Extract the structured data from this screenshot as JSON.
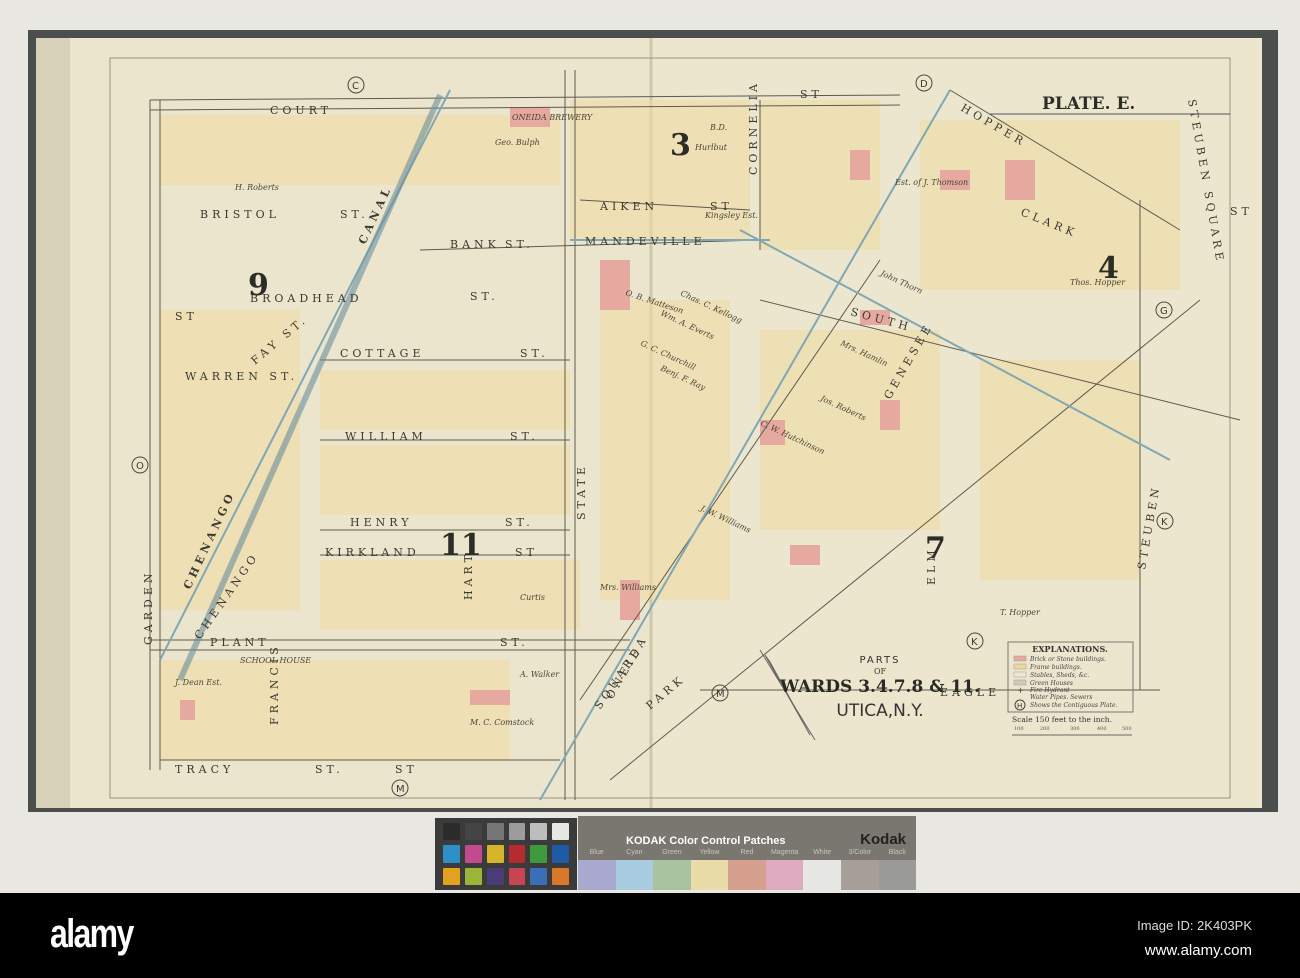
{
  "plate_title": "PLATE. E.",
  "cartouche": {
    "line1": "PARTS",
    "line2": "OF",
    "line3": "WARDS 3.4.7.8 & 11.",
    "line4": "UTICA,N.Y."
  },
  "legend": {
    "title": "EXPLANATIONS.",
    "items": [
      "Brick or Stone buildings.",
      "Frame buildings.",
      "Stables, Sheds, &c.",
      "Green Houses",
      "Fire Hydrant",
      "Water Pipes.  Sewers",
      "Shows the Contiguous Plate."
    ],
    "hydrant_symbol": "+",
    "plate_symbol": "H",
    "scale": "Scale 150 feet to the inch.",
    "scale_ticks": [
      "100",
      "200",
      "300",
      "400",
      "500"
    ],
    "colors": {
      "brick": "#e6a9a0",
      "frame": "#efd79a",
      "stable": "#ece8d4",
      "green": "#cfcab7"
    }
  },
  "streets": [
    "COURT",
    "ST",
    "BROADHEAD",
    "ST.",
    "BRISTOL",
    "ST.",
    "AIKEN",
    "ST",
    "BANK",
    "ST.",
    "MANDEVILLE",
    "COTTAGE",
    "ST.",
    "WILLIAM",
    "ST.",
    "HENRY",
    "ST.",
    "KIRKLAND",
    "ST",
    "PLANT",
    "ST.",
    "TRACY",
    "ST.",
    "GARDEN",
    "CHENANGO",
    "CANAL",
    "HART",
    "STATE",
    "CORNELIA",
    "HOPPER",
    "CLARK",
    "SOUTH",
    "ELM",
    "EAGLE",
    "SQUARE",
    "PARK",
    "STEUBEN",
    "STEUBEN SQUARE",
    "WARREN ST.",
    "FAY ST.",
    "FRANCIS",
    "GENESEE",
    "CHENANGO",
    "ONEIDA",
    "ST",
    "ST",
    "ST"
  ],
  "owners": [
    "H. Roberts",
    "Geo. Bulph",
    "B.D.",
    "Hurlbut",
    "Kingsley Est.",
    "O. B. Matteson",
    "John Thorn",
    "Wm. A. Everts",
    "Chas. C. Kellogg",
    "Benj. F. Ray",
    "G. C. Churchill",
    "J. W. Williams",
    "C. W. Hutchinson",
    "Mrs. Hamlin",
    "Jos. Roberts",
    "A. Walker",
    "M. C. Comstock",
    "J. Dean Est.",
    "Curtis",
    "Thos. Hopper",
    "T. Hopper",
    "ONEIDA BREWERY",
    "Mrs. Williams",
    "Est. of J. Thomson",
    "SCHOOL HOUSE"
  ],
  "wards": [
    "9",
    "3",
    "4",
    "7",
    "11"
  ],
  "grid_refs": [
    "C",
    "D",
    "G",
    "O",
    "K",
    "M",
    "K",
    "M",
    "C",
    "H"
  ],
  "kodak": {
    "title": "KODAK Color Control Patches",
    "brand": "Kodak",
    "labels": [
      "Blue",
      "Cyan",
      "Green",
      "Yellow",
      "Red",
      "Magenta",
      "White",
      "3/Color",
      "Black"
    ],
    "patch_colors": [
      "#a9a8cf",
      "#a9cde0",
      "#a9c3a0",
      "#e9dca8",
      "#d6a08f",
      "#ddaac0",
      "#e6e6e2",
      "#a79e99",
      "#9a9b96"
    ]
  },
  "checker_colors": [
    "#2b2b2b",
    "#444",
    "#777",
    "#9c9c9c",
    "#bdbdbd",
    "#e6e6e2",
    "#2f90c9",
    "#c24b8d",
    "#d7b52b",
    "#b62a30",
    "#3e9a3c",
    "#1f5aa6",
    "#e0a21f",
    "#9ab538",
    "#4a3b79",
    "#c84452",
    "#3a6fb8",
    "#d9782a"
  ],
  "watermark": {
    "logo": "alamy",
    "image_id": "Image ID: 2K403PK",
    "site": "www.alamy.com"
  }
}
